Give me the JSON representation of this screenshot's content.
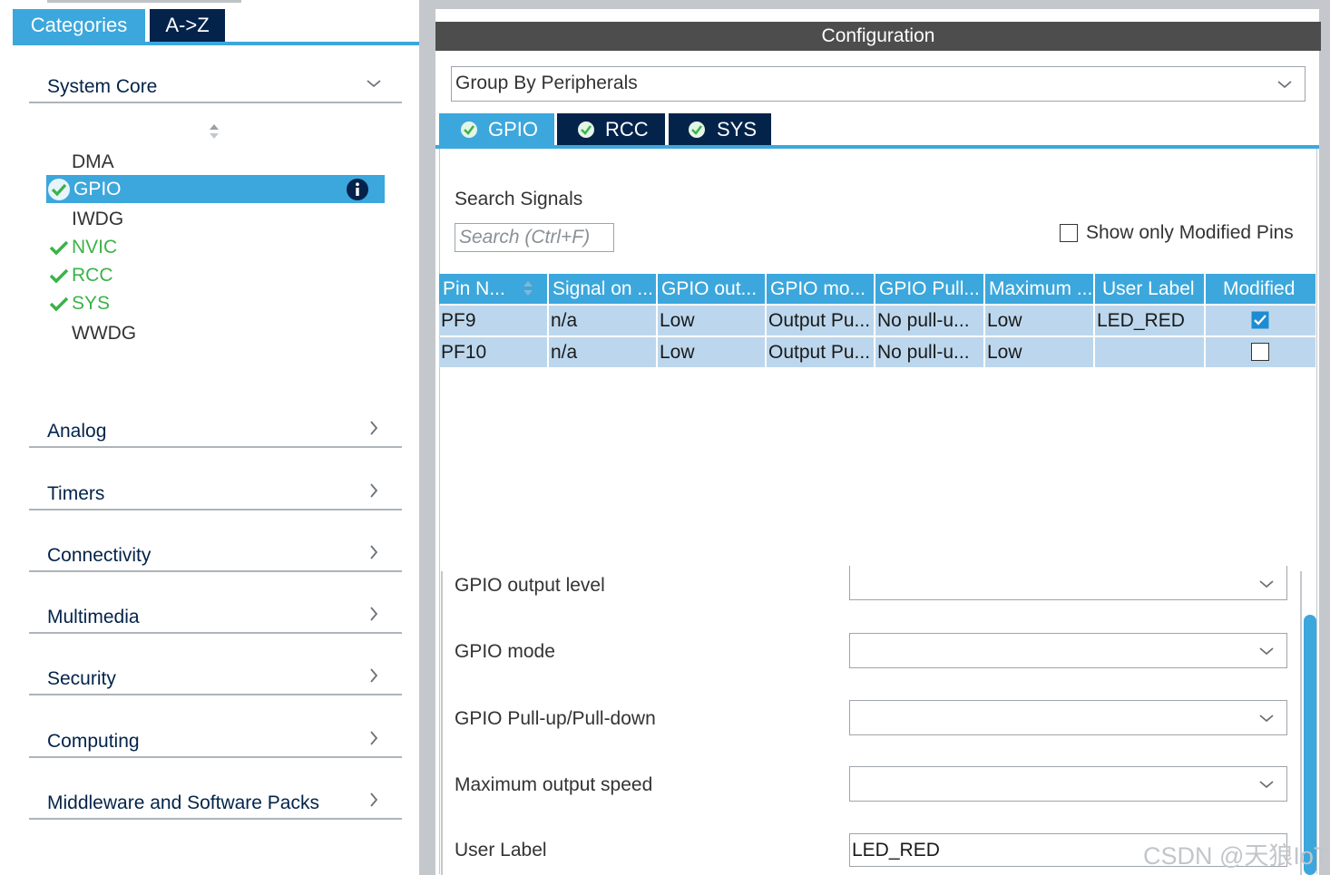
{
  "left_tabs": {
    "categories": "Categories",
    "atoz": "A->Z"
  },
  "system_core": {
    "label": "System Core",
    "items": [
      {
        "label": "DMA",
        "state": "normal"
      },
      {
        "label": "GPIO",
        "state": "selected"
      },
      {
        "label": "IWDG",
        "state": "normal"
      },
      {
        "label": "NVIC",
        "state": "green"
      },
      {
        "label": "RCC",
        "state": "green"
      },
      {
        "label": "SYS",
        "state": "green"
      },
      {
        "label": "WWDG",
        "state": "normal"
      }
    ]
  },
  "categories": [
    "Analog",
    "Timers",
    "Connectivity",
    "Multimedia",
    "Security",
    "Computing",
    "Middleware and Software Packs"
  ],
  "config": {
    "header": "Configuration",
    "group_by": "Group By Peripherals",
    "tabs": [
      "GPIO",
      "RCC",
      "SYS"
    ],
    "search_label": "Search Signals",
    "search_placeholder": "Search (Ctrl+F)",
    "show_modified_label": "Show only Modified Pins",
    "table": {
      "headers": [
        "Pin N...",
        "Signal on ...",
        "GPIO out...",
        "GPIO mo...",
        "GPIO Pull...",
        "Maximum ...",
        "User Label",
        "Modified"
      ],
      "rows": [
        {
          "cells": [
            "PF9",
            "n/a",
            "Low",
            "Output Pu...",
            "No pull-u...",
            "Low",
            "LED_RED"
          ],
          "modified": true
        },
        {
          "cells": [
            "PF10",
            "n/a",
            "Low",
            "Output Pu...",
            "No pull-u...",
            "Low",
            ""
          ],
          "modified": false
        }
      ]
    },
    "form": {
      "output_level_label": "GPIO output level",
      "mode_label": "GPIO mode",
      "pull_label": "GPIO Pull-up/Pull-down",
      "speed_label": "Maximum output speed",
      "user_label_label": "User Label",
      "user_label_value": "LED_RED"
    }
  },
  "watermark": "CSDN @天狼IoT",
  "colors": {
    "accent": "#3ca7dc",
    "navy": "#03234b",
    "green": "#3cb24a",
    "row_bg": "#bcd7ed",
    "header_bg": "#4d4d4d"
  }
}
